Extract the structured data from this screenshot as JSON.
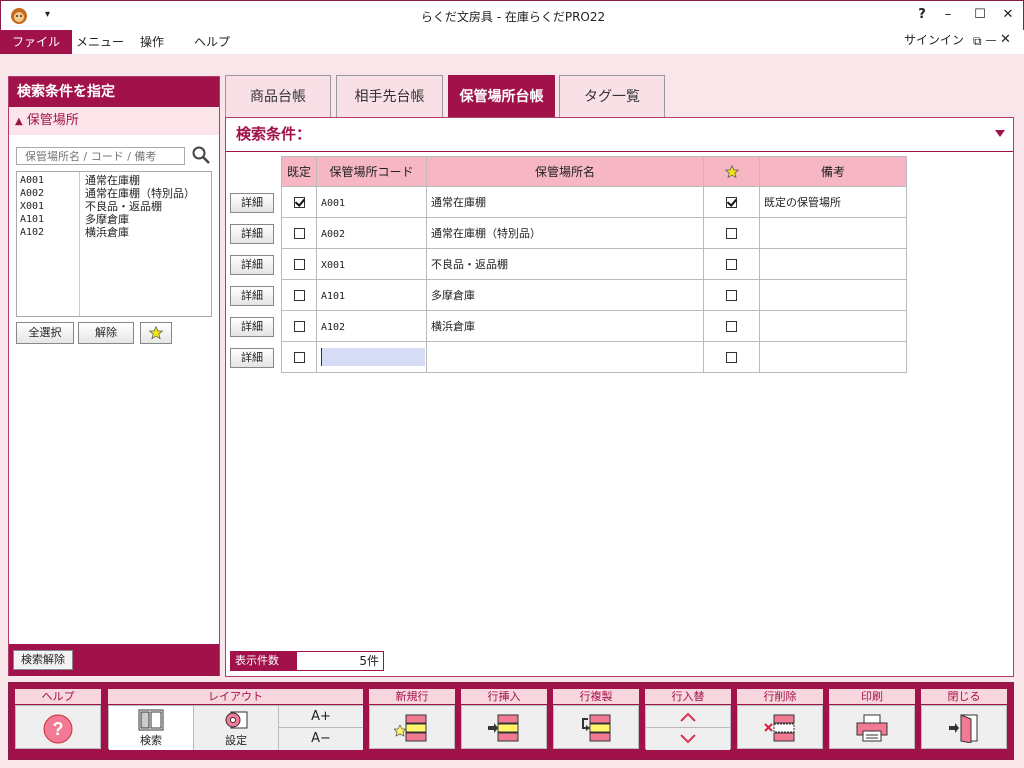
{
  "window": {
    "title": "らくだ文房具 - 在庫らくだPRO22",
    "help": "?",
    "minimize": "–",
    "maximize": "☐",
    "close": "✕"
  },
  "menu": {
    "file": "ファイル",
    "menu": "メニュー",
    "operation": "操作",
    "help": "ヘルプ",
    "signin": "サインイン"
  },
  "left": {
    "header": "検索条件を指定",
    "section": "保管場所",
    "search_placeholder": "保管場所名 / コード / 備考",
    "items": [
      {
        "code": "A001",
        "name": "通常在庫棚"
      },
      {
        "code": "A002",
        "name": "通常在庫棚（特別品）"
      },
      {
        "code": "X001",
        "name": "不良品・返品棚"
      },
      {
        "code": "A101",
        "name": "多摩倉庫"
      },
      {
        "code": "A102",
        "name": "横浜倉庫"
      }
    ],
    "select_all": "全選択",
    "release": "解除",
    "clear_search": "検索解除"
  },
  "tabs": [
    {
      "label": "商品台帳",
      "active": false
    },
    {
      "label": "相手先台帳",
      "active": false
    },
    {
      "label": "保管場所台帳",
      "active": true
    },
    {
      "label": "タグ一覧",
      "active": false
    }
  ],
  "search_condition": "検索条件：",
  "grid": {
    "columns": [
      "既定",
      "保管場所コード",
      "保管場所名",
      "",
      "備考"
    ],
    "detail_label": "詳細",
    "rows": [
      {
        "default": true,
        "code": "A001",
        "name": "通常在庫棚",
        "star": true,
        "note": "既定の保管場所"
      },
      {
        "default": false,
        "code": "A002",
        "name": "通常在庫棚（特別品）",
        "star": false,
        "note": ""
      },
      {
        "default": false,
        "code": "X001",
        "name": "不良品・返品棚",
        "star": false,
        "note": ""
      },
      {
        "default": false,
        "code": "A101",
        "name": "多摩倉庫",
        "star": false,
        "note": ""
      },
      {
        "default": false,
        "code": "A102",
        "name": "横浜倉庫",
        "star": false,
        "note": ""
      },
      {
        "default": false,
        "code": "",
        "name": "",
        "star": false,
        "note": ""
      }
    ]
  },
  "count": {
    "label": "表示件数",
    "value": "5件"
  },
  "toolbar": {
    "help": "ヘルプ",
    "layout": "レイアウト",
    "search": "検索",
    "settings": "設定",
    "font_up": "A+",
    "font_down": "A−",
    "new_row": "新規行",
    "insert_row": "行挿入",
    "copy_row": "行複製",
    "swap_row": "行入替",
    "delete_row": "行削除",
    "print": "印刷",
    "close": "閉じる"
  },
  "colors": {
    "accent": "#a2124a",
    "header_pink": "#f6b6c4",
    "bg_pink": "#f9e6ea"
  }
}
